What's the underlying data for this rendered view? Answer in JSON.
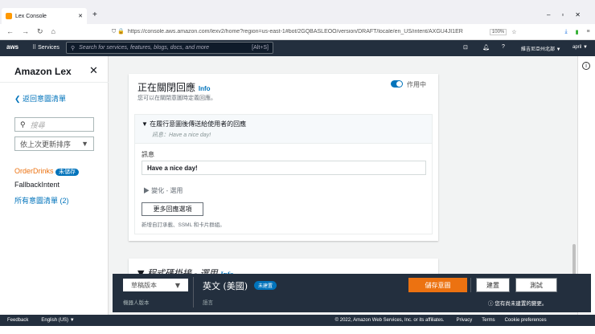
{
  "browser": {
    "tab_title": "Lex Console",
    "url": "https://console.aws.amazon.com/lexv2/home?region=us-east-1#bot/2GQBASLEOO/version/DRAFT/locale/en_US/intent/AXGU4JI1ER",
    "zoom": "100%"
  },
  "aws": {
    "services": "Services",
    "search_placeholder": "Search for services, features, blogs, docs, and more",
    "shortcut": "[Alt+S]",
    "region": "維吉尼亞州北部 ▼",
    "user": "april ▼"
  },
  "sidebar": {
    "title": "Amazon Lex",
    "back": "返回意圖清單",
    "search_placeholder": "搜尋",
    "sort": "依上次更新排序",
    "intents": [
      {
        "name": "OrderDrinks",
        "badge": "未儲存"
      },
      {
        "name": "FallbackIntent"
      }
    ],
    "all_intents": "所有意圖清單 (2)"
  },
  "closing": {
    "title": "正在關閉回應",
    "info": "Info",
    "desc": "您可以在關閉意圖時定義回應。",
    "toggle_label": "作用中",
    "toggle_on": true,
    "section_title": "在履行意圖後傳送給使用者的回應",
    "section_sub": "訊息：Have a nice day!",
    "message_label": "訊息",
    "message_value": "Have a nice day!",
    "variations": "變化 - 選用",
    "more_button": "更多回應選項",
    "more_desc": "新增自訂承載、SSML 和卡片群組。"
  },
  "code_hook": {
    "title": "程式碼掛接 - 選用",
    "info": "Info"
  },
  "bottom": {
    "version": "草稿版本",
    "version_label": "機器人版本",
    "language": "英文 (美國)",
    "lang_badge": "未建置",
    "language_label": "語言",
    "save": "儲存意圖",
    "build": "建置",
    "test": "測試",
    "notice": "您有尚未建置的變更。"
  },
  "footer": {
    "feedback": "Feedback",
    "language": "English (US) ▼",
    "copyright": "© 2022, Amazon Web Services, Inc. or its affiliates.",
    "privacy": "Privacy",
    "terms": "Terms",
    "cookies": "Cookie preferences"
  }
}
